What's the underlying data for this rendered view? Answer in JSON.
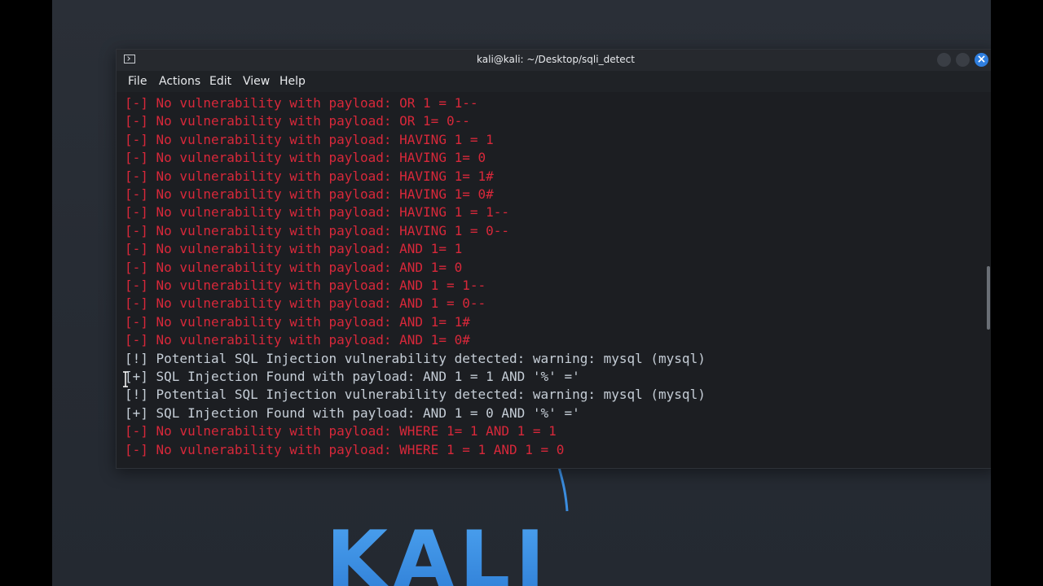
{
  "window": {
    "title": "kali@kali: ~/Desktop/sqli_detect",
    "close_glyph": "×"
  },
  "menu": {
    "items": [
      "File",
      "Actions",
      "Edit",
      "View",
      "Help"
    ]
  },
  "terminal": {
    "lines": [
      {
        "text": "[-] No vulnerability with payload: OR 1 = 1--",
        "status": "error"
      },
      {
        "text": "[-] No vulnerability with payload: OR 1= 0--",
        "status": "error"
      },
      {
        "text": "[-] No vulnerability with payload: HAVING 1 = 1",
        "status": "error"
      },
      {
        "text": "[-] No vulnerability with payload: HAVING 1= 0",
        "status": "error"
      },
      {
        "text": "[-] No vulnerability with payload: HAVING 1= 1#",
        "status": "error"
      },
      {
        "text": "[-] No vulnerability with payload: HAVING 1= 0#",
        "status": "error"
      },
      {
        "text": "[-] No vulnerability with payload: HAVING 1 = 1--",
        "status": "error"
      },
      {
        "text": "[-] No vulnerability with payload: HAVING 1 = 0--",
        "status": "error"
      },
      {
        "text": "[-] No vulnerability with payload: AND 1= 1",
        "status": "error"
      },
      {
        "text": "[-] No vulnerability with payload: AND 1= 0",
        "status": "error"
      },
      {
        "text": "[-] No vulnerability with payload: AND 1 = 1--",
        "status": "error"
      },
      {
        "text": "[-] No vulnerability with payload: AND 1 = 0--",
        "status": "error"
      },
      {
        "text": "[-] No vulnerability with payload: AND 1= 1#",
        "status": "error"
      },
      {
        "text": "[-] No vulnerability with payload: AND 1= 0#",
        "status": "error"
      },
      {
        "text": "[!] Potential SQL Injection vulnerability detected: warning: mysql (mysql)",
        "status": "ok"
      },
      {
        "text": "[+] SQL Injection Found with payload: AND 1 = 1 AND '%' ='",
        "status": "ok"
      },
      {
        "text": "[!] Potential SQL Injection vulnerability detected: warning: mysql (mysql)",
        "status": "ok"
      },
      {
        "text": "[+] SQL Injection Found with payload: AND 1 = 0 AND '%' ='",
        "status": "ok"
      },
      {
        "text": "[-] No vulnerability with payload: WHERE 1= 1 AND 1 = 1",
        "status": "error"
      },
      {
        "text": "[-] No vulnerability with payload: WHERE 1 = 1 AND 1 = 0",
        "status": "error"
      }
    ]
  },
  "desktop": {
    "logo_text": "KALI"
  },
  "colors": {
    "error": "#d8283a",
    "ok": "#c5cdd6",
    "accent": "#2f7fe0"
  }
}
